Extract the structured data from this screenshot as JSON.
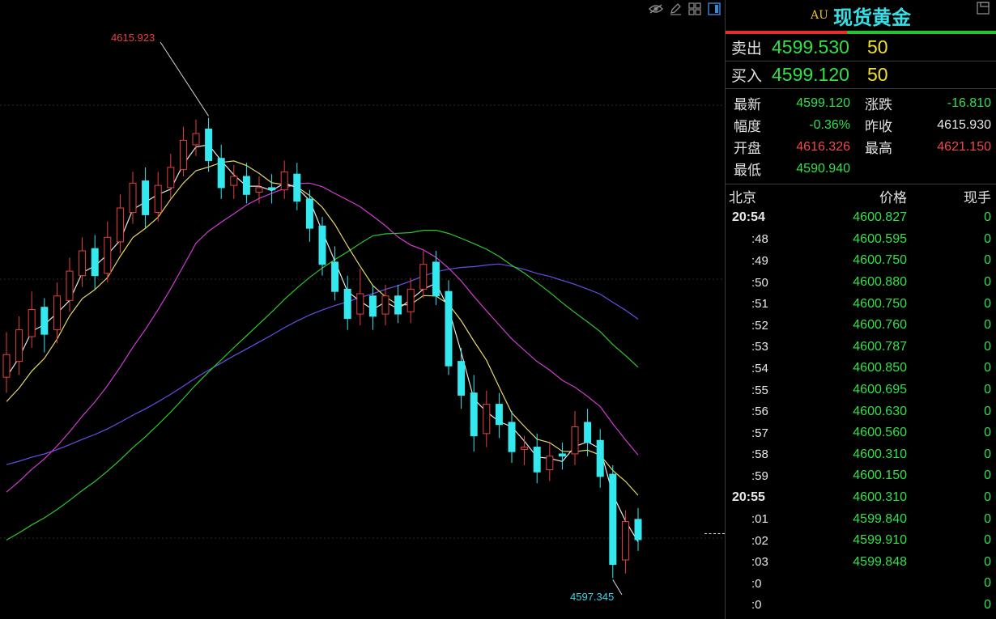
{
  "chart": {
    "high_marker": "4615.923",
    "low_marker": "4597.345",
    "toolbar_icons": [
      "eye-icon",
      "pencil-icon",
      "grid-icon",
      "panel-icon"
    ],
    "colors": {
      "up": "#e84040",
      "down": "#34e8f0",
      "ma1": "#e8e8e8",
      "ma2": "#e6d86a",
      "ma3": "#d23bd2",
      "ma4": "#2ec82e",
      "ma5": "#6a4de8"
    }
  },
  "chart_data": {
    "type": "candlestick",
    "ylim": [
      4594.5,
      4620.5
    ],
    "candles": [
      {
        "o": 4604.5,
        "c": 4605.5,
        "h": 4606.5,
        "l": 4603.8
      },
      {
        "o": 4605.2,
        "c": 4606.6,
        "h": 4607.2,
        "l": 4604.6
      },
      {
        "o": 4606.3,
        "c": 4607.5,
        "h": 4608.3,
        "l": 4605.8
      },
      {
        "o": 4607.6,
        "c": 4606.4,
        "h": 4608.0,
        "l": 4605.6
      },
      {
        "o": 4606.6,
        "c": 4608.1,
        "h": 4608.7,
        "l": 4606.0
      },
      {
        "o": 4607.9,
        "c": 4609.2,
        "h": 4609.8,
        "l": 4607.4
      },
      {
        "o": 4609.0,
        "c": 4610.1,
        "h": 4610.7,
        "l": 4608.5
      },
      {
        "o": 4610.2,
        "c": 4609.0,
        "h": 4610.8,
        "l": 4608.4
      },
      {
        "o": 4609.1,
        "c": 4610.7,
        "h": 4611.4,
        "l": 4608.7
      },
      {
        "o": 4610.5,
        "c": 4612.0,
        "h": 4612.6,
        "l": 4610.0
      },
      {
        "o": 4611.8,
        "c": 4613.1,
        "h": 4613.6,
        "l": 4611.3
      },
      {
        "o": 4613.2,
        "c": 4611.7,
        "h": 4613.8,
        "l": 4611.1
      },
      {
        "o": 4611.8,
        "c": 4613.0,
        "h": 4613.6,
        "l": 4611.4
      },
      {
        "o": 4612.9,
        "c": 4613.8,
        "h": 4614.4,
        "l": 4612.4
      },
      {
        "o": 4613.7,
        "c": 4615.0,
        "h": 4615.6,
        "l": 4613.4
      },
      {
        "o": 4614.8,
        "c": 4615.3,
        "h": 4615.923,
        "l": 4614.3
      },
      {
        "o": 4615.5,
        "c": 4614.1,
        "h": 4616.0,
        "l": 4613.6
      },
      {
        "o": 4614.2,
        "c": 4612.9,
        "h": 4614.8,
        "l": 4612.4
      },
      {
        "o": 4613.0,
        "c": 4613.4,
        "h": 4613.9,
        "l": 4612.4
      },
      {
        "o": 4613.4,
        "c": 4612.6,
        "h": 4614.0,
        "l": 4612.2
      },
      {
        "o": 4612.7,
        "c": 4612.9,
        "h": 4613.4,
        "l": 4612.2
      },
      {
        "o": 4612.9,
        "c": 4612.8,
        "h": 4613.5,
        "l": 4612.2
      },
      {
        "o": 4612.8,
        "c": 4613.6,
        "h": 4614.1,
        "l": 4612.4
      },
      {
        "o": 4613.5,
        "c": 4612.3,
        "h": 4614.0,
        "l": 4611.9
      },
      {
        "o": 4612.4,
        "c": 4611.1,
        "h": 4612.8,
        "l": 4610.5
      },
      {
        "o": 4611.2,
        "c": 4609.5,
        "h": 4611.6,
        "l": 4609.0
      },
      {
        "o": 4609.6,
        "c": 4608.3,
        "h": 4610.3,
        "l": 4607.9
      },
      {
        "o": 4608.4,
        "c": 4607.1,
        "h": 4609.0,
        "l": 4606.6
      },
      {
        "o": 4607.3,
        "c": 4608.2,
        "h": 4609.3,
        "l": 4606.8
      },
      {
        "o": 4608.1,
        "c": 4607.2,
        "h": 4608.6,
        "l": 4606.6
      },
      {
        "o": 4607.3,
        "c": 4608.1,
        "h": 4608.6,
        "l": 4606.8
      },
      {
        "o": 4608.1,
        "c": 4607.3,
        "h": 4608.6,
        "l": 4606.9
      },
      {
        "o": 4607.4,
        "c": 4608.4,
        "h": 4608.9,
        "l": 4606.9
      },
      {
        "o": 4608.4,
        "c": 4609.5,
        "h": 4610.1,
        "l": 4608.0
      },
      {
        "o": 4609.6,
        "c": 4608.1,
        "h": 4610.1,
        "l": 4607.7
      },
      {
        "o": 4608.3,
        "c": 4605.0,
        "h": 4608.8,
        "l": 4604.6
      },
      {
        "o": 4605.2,
        "c": 4603.7,
        "h": 4605.8,
        "l": 4603.1
      },
      {
        "o": 4603.8,
        "c": 4601.9,
        "h": 4604.6,
        "l": 4601.2
      },
      {
        "o": 4602.0,
        "c": 4603.3,
        "h": 4603.9,
        "l": 4601.4
      },
      {
        "o": 4603.3,
        "c": 4602.4,
        "h": 4603.8,
        "l": 4601.8
      },
      {
        "o": 4602.5,
        "c": 4601.2,
        "h": 4603.0,
        "l": 4600.7
      },
      {
        "o": 4601.3,
        "c": 4601.4,
        "h": 4601.9,
        "l": 4600.6
      },
      {
        "o": 4601.4,
        "c": 4600.3,
        "h": 4602.0,
        "l": 4599.8
      },
      {
        "o": 4600.4,
        "c": 4601.0,
        "h": 4601.6,
        "l": 4599.9
      },
      {
        "o": 4601.1,
        "c": 4601.0,
        "h": 4601.6,
        "l": 4600.4
      },
      {
        "o": 4601.1,
        "c": 4602.3,
        "h": 4603.0,
        "l": 4600.6
      },
      {
        "o": 4602.5,
        "c": 4601.6,
        "h": 4603.1,
        "l": 4601.0
      },
      {
        "o": 4601.7,
        "c": 4600.1,
        "h": 4602.2,
        "l": 4599.6
      },
      {
        "o": 4600.2,
        "c": 4596.2,
        "h": 4600.6,
        "l": 4595.6
      },
      {
        "o": 4596.4,
        "c": 4598.1,
        "h": 4598.6,
        "l": 4595.8
      },
      {
        "o": 4598.2,
        "c": 4597.3,
        "h": 4598.7,
        "l": 4596.8
      }
    ]
  },
  "sidebar": {
    "title_code": "AU",
    "title_name": "现货黄金",
    "corner_icon": "window-restore-icon",
    "sell_label": "卖出",
    "sell_price": "4599.530",
    "sell_vol": "50",
    "buy_label": "买入",
    "buy_price": "4599.120",
    "buy_vol": "50",
    "stats": {
      "latest_label": "最新",
      "latest": "4599.120",
      "change_label": "涨跌",
      "change": "-16.810",
      "pct_label": "幅度",
      "pct": "-0.36%",
      "prev_close_label": "昨收",
      "prev_close": "4615.930",
      "open_label": "开盘",
      "open": "4616.326",
      "high_label": "最高",
      "high": "4621.150",
      "low_label": "最低",
      "low": "4590.940"
    },
    "ticks_header": {
      "time": "北京",
      "price": "价格",
      "vol": "现手"
    },
    "ticks": [
      {
        "t": "20:54",
        "p": "4600.827",
        "v": "0"
      },
      {
        "t": ":48",
        "p": "4600.595",
        "v": "0"
      },
      {
        "t": ":49",
        "p": "4600.750",
        "v": "0"
      },
      {
        "t": ":50",
        "p": "4600.880",
        "v": "0"
      },
      {
        "t": ":51",
        "p": "4600.750",
        "v": "0"
      },
      {
        "t": ":52",
        "p": "4600.760",
        "v": "0"
      },
      {
        "t": ":53",
        "p": "4600.787",
        "v": "0"
      },
      {
        "t": ":54",
        "p": "4600.850",
        "v": "0"
      },
      {
        "t": ":55",
        "p": "4600.695",
        "v": "0"
      },
      {
        "t": ":56",
        "p": "4600.630",
        "v": "0"
      },
      {
        "t": ":57",
        "p": "4600.560",
        "v": "0"
      },
      {
        "t": ":58",
        "p": "4600.310",
        "v": "0"
      },
      {
        "t": ":59",
        "p": "4600.150",
        "v": "0"
      },
      {
        "t": "20:55",
        "p": "4600.310",
        "v": "0"
      },
      {
        "t": ":01",
        "p": "4599.840",
        "v": "0"
      },
      {
        "t": ":02",
        "p": "4599.910",
        "v": "0"
      },
      {
        "t": ":03",
        "p": "4599.848",
        "v": "0"
      },
      {
        "t": ":0",
        "p": "",
        "v": "0"
      },
      {
        "t": ":0",
        "p": "",
        "v": "0"
      }
    ]
  }
}
